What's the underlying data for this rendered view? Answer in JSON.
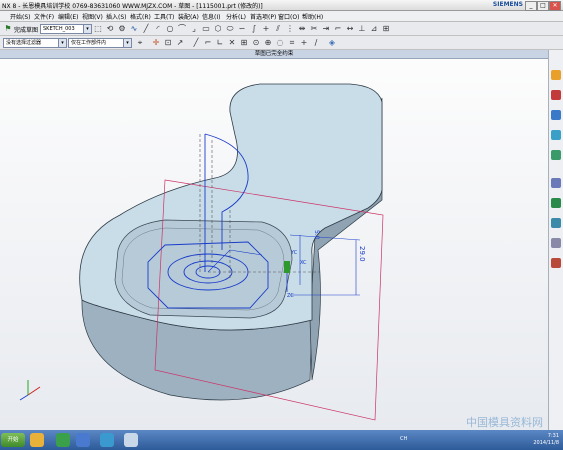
{
  "window": {
    "title": "NX 8 - 长恩模具培训学校   0769-83631060  WWW.MJZX.COM - 草图 - [1115001.prt (修改的)]",
    "brand": "SIEMENS",
    "minimize": "_",
    "maximize": "□",
    "close": "✕"
  },
  "menu": {
    "items": [
      "开始(S)",
      "文件(F)",
      "编辑(E)",
      "视图(V)",
      "插入(S)",
      "格式(R)",
      "工具(T)",
      "装配(A)",
      "信息(I)",
      "分析(L)",
      "首选项(P)",
      "窗口(O)",
      "帮助(H)"
    ]
  },
  "toolbar": {
    "finish_sketch": "完成草图",
    "sketch_name": "SKETCH_003",
    "filter_select": "没有选择过滤器",
    "assembly_scope": "仅在工作部件内"
  },
  "viewport": {
    "title": "草图已完全约束",
    "dimensions": [
      "5.0",
      "29.0",
      "XC",
      "YC",
      "ZC"
    ]
  },
  "taskbar": {
    "start_label": "开始",
    "time": "7:31",
    "date": "2014/11/8",
    "tray_lang": "CH"
  },
  "watermark": "中国模具资料网",
  "colors": {
    "part_face": "#c9dde9",
    "part_side": "#9eb1c0",
    "sketch_line": "#1a3cc9",
    "datum_plane": "#cc3366",
    "accent": "#3a6fb5"
  }
}
